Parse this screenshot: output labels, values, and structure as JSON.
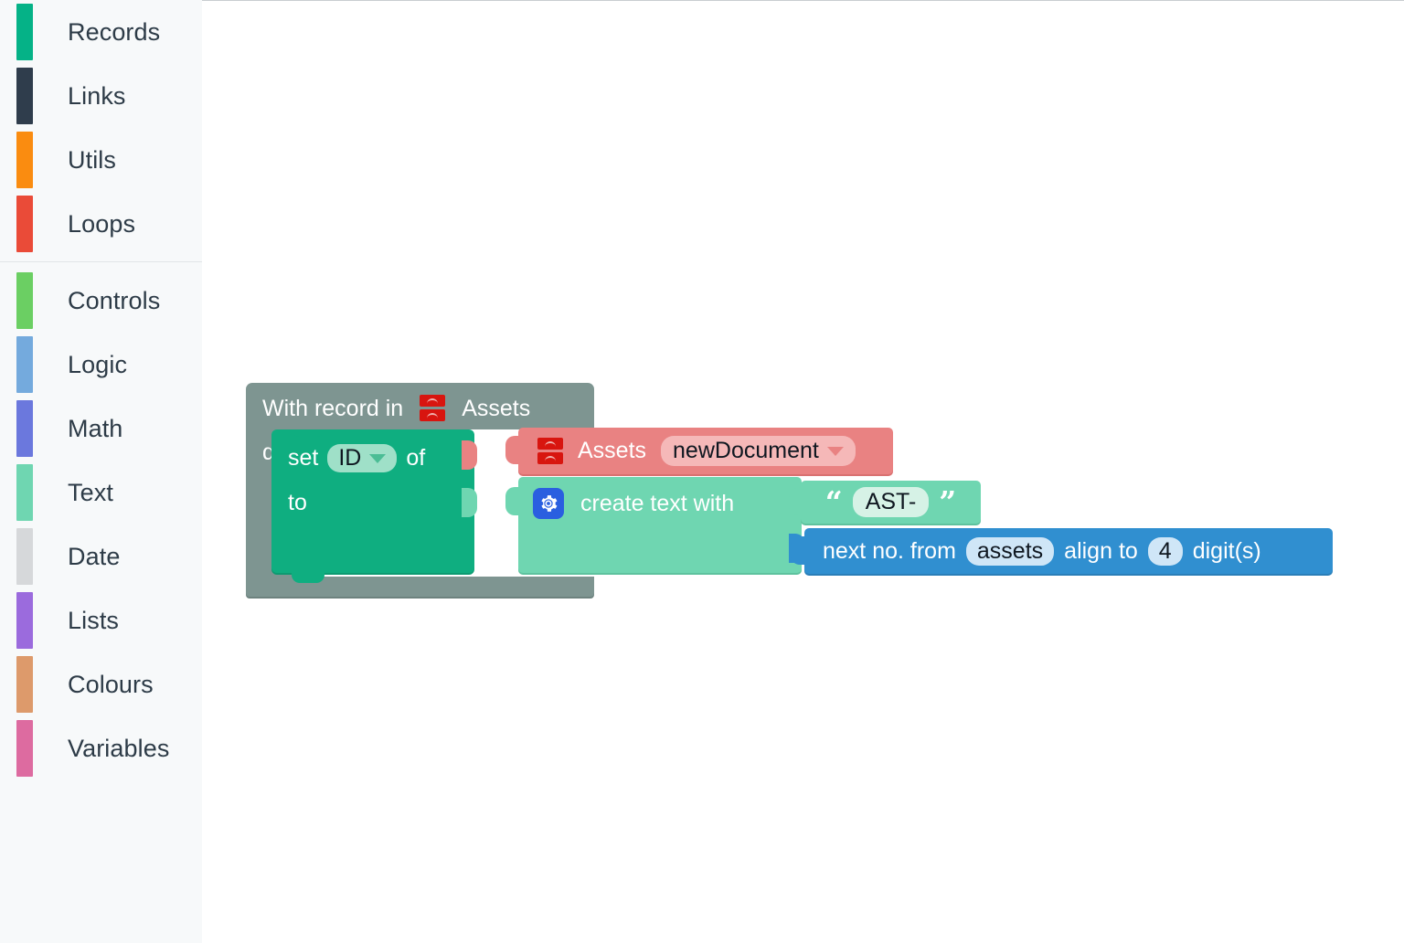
{
  "toolbox": {
    "groups": [
      {
        "name": "primary",
        "items": [
          {
            "label": "Records",
            "color": "#05b287",
            "icon": "category-swatch"
          },
          {
            "label": "Links",
            "color": "#2f3d4c",
            "icon": "category-swatch"
          },
          {
            "label": "Utils",
            "color": "#fa8c10",
            "icon": "category-swatch"
          },
          {
            "label": "Loops",
            "color": "#ea4b38",
            "icon": "category-swatch"
          }
        ]
      },
      {
        "name": "standard",
        "items": [
          {
            "label": "Controls",
            "color": "#6bcf63",
            "icon": "category-swatch"
          },
          {
            "label": "Logic",
            "color": "#74aadd",
            "icon": "category-swatch"
          },
          {
            "label": "Math",
            "color": "#6b78dd",
            "icon": "category-swatch"
          },
          {
            "label": "Text",
            "color": "#6fd6b1",
            "icon": "category-swatch"
          },
          {
            "label": "Date",
            "color": "#d6d8da",
            "icon": "category-swatch"
          },
          {
            "label": "Lists",
            "color": "#9b6bdd",
            "icon": "category-swatch"
          },
          {
            "label": "Colours",
            "color": "#dd9a6b",
            "icon": "category-swatch"
          },
          {
            "label": "Variables",
            "color": "#dd6ba0",
            "icon": "category-swatch"
          }
        ]
      }
    ]
  },
  "workspace": {
    "blocks": {
      "with_record": {
        "prefix_label": "With record in",
        "record_icon": "record-icon",
        "table_name": "Assets",
        "do_label": "do",
        "color": "#7e9591"
      },
      "set_field": {
        "set_label": "set",
        "field_value": "ID",
        "of_label": "of",
        "to_label": "to",
        "color": "#0fae80",
        "dropdown_icon": "chevron-down-icon"
      },
      "assets_record": {
        "record_icon": "record-icon",
        "table_name": "Assets",
        "record_value": "newDocument",
        "color": "#e98282",
        "dropdown_icon": "chevron-down-icon"
      },
      "create_text": {
        "mutator_icon": "gear-icon",
        "label": "create text with",
        "color": "#6fd6b1"
      },
      "text_literal": {
        "open_quote": "“",
        "value": "AST-",
        "close_quote": "”",
        "color": "#6fd6b1"
      },
      "next_number": {
        "prefix_label": "next no. from",
        "source_value": "assets",
        "align_label": "align to",
        "digits_value": "4",
        "suffix_label": "digit(s)",
        "color": "#308fd0"
      }
    }
  }
}
